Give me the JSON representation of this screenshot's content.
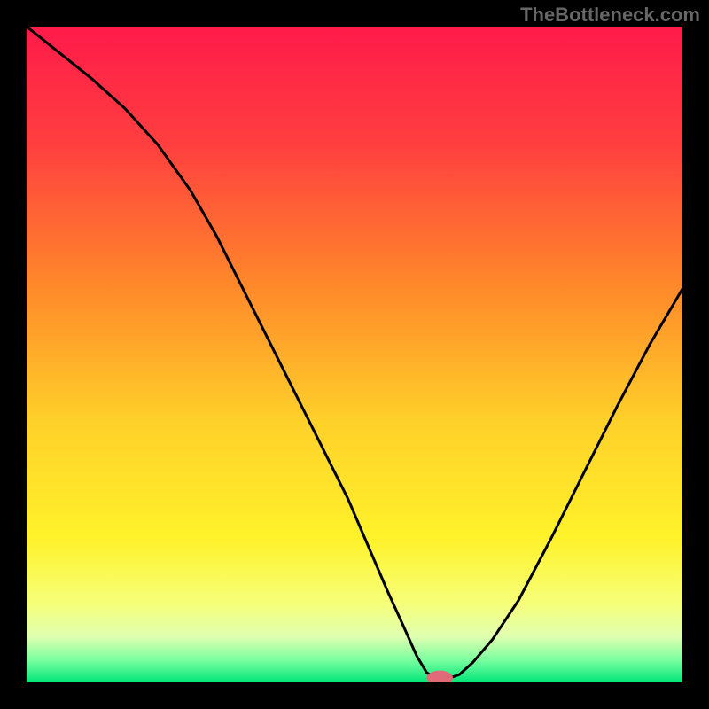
{
  "watermark": "TheBottleneck.com",
  "chart_data": {
    "type": "line",
    "title": "",
    "xlabel": "",
    "ylabel": "",
    "xlim": [
      0,
      100
    ],
    "ylim": [
      0,
      100
    ],
    "gradient_stops": [
      {
        "offset": 0,
        "color": "#ff1a4a"
      },
      {
        "offset": 0.18,
        "color": "#ff3f3f"
      },
      {
        "offset": 0.4,
        "color": "#ff8a2a"
      },
      {
        "offset": 0.6,
        "color": "#ffd02a"
      },
      {
        "offset": 0.78,
        "color": "#fff22a"
      },
      {
        "offset": 0.88,
        "color": "#f6ff7a"
      },
      {
        "offset": 0.93,
        "color": "#e0ffb0"
      },
      {
        "offset": 0.965,
        "color": "#7effa0"
      },
      {
        "offset": 1.0,
        "color": "#00e67a"
      }
    ],
    "series": [
      {
        "name": "bottleneck-curve",
        "x": [
          0,
          5,
          10,
          15,
          20,
          25,
          29,
          33,
          37,
          41,
          45,
          49,
          52,
          55,
          57.5,
          59.5,
          61,
          62.5,
          64,
          66,
          68,
          71,
          75,
          80,
          85,
          90,
          95,
          100
        ],
        "y": [
          100,
          96,
          92,
          87.5,
          82,
          75,
          68,
          60,
          52,
          44,
          36,
          28,
          21,
          14,
          8.5,
          4,
          1.5,
          0.5,
          0.5,
          1.2,
          3,
          6.5,
          12.5,
          22,
          32,
          42,
          51.5,
          60
        ]
      }
    ],
    "marker": {
      "name": "optimal-point",
      "x": 63,
      "y": 0.7,
      "color": "#e06a78",
      "rx": 2.0,
      "ry": 1.1
    }
  }
}
